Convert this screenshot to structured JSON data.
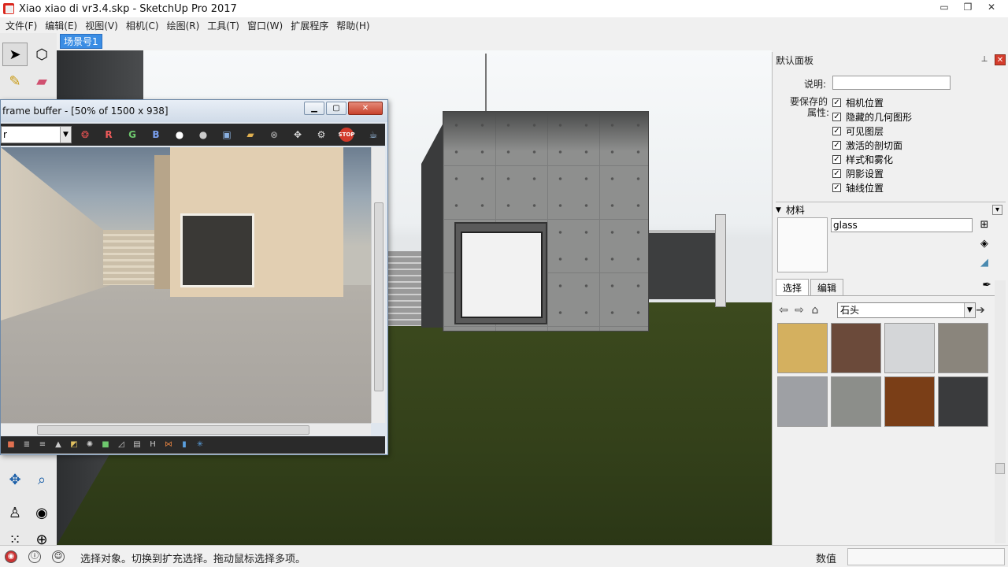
{
  "window": {
    "title": "Xiao xiao di vr3.4.skp - SketchUp Pro 2017",
    "minimize": "▭",
    "restore": "❐",
    "close": "✕"
  },
  "menu": [
    "文件(F)",
    "编辑(E)",
    "视图(V)",
    "相机(C)",
    "绘图(R)",
    "工具(T)",
    "窗口(W)",
    "扩展程序",
    "帮助(H)"
  ],
  "scene_tab": "场景号1",
  "frame_buffer": {
    "title": "frame buffer - [50% of 1500 x 938]",
    "channel_select": "r",
    "toolbar_buttons": [
      "R",
      "G",
      "B"
    ]
  },
  "default_tray": {
    "title": "默认面板",
    "description_label": "说明:",
    "properties_label_line1": "要保存的",
    "properties_label_line2": "属性:",
    "checkboxes": [
      "相机位置",
      "隐藏的几何图形",
      "可见图层",
      "激活的剖切面",
      "样式和雾化",
      "阴影设置",
      "轴线位置"
    ]
  },
  "materials": {
    "section_title": "材料",
    "current_name": "glass",
    "tab_select": "选择",
    "tab_edit": "编辑",
    "collection": "石头",
    "swatch_colors": [
      "#d4b05f",
      "#6b4a3a",
      "#d4d6d8",
      "#8a857c",
      "#9ea0a4",
      "#8c8e8a",
      "#7a3e17",
      "#3a3b3d"
    ]
  },
  "status": {
    "text": "选择对象。切换到扩充选择。拖动鼠标选择多项。",
    "measurements_label": "数值"
  }
}
